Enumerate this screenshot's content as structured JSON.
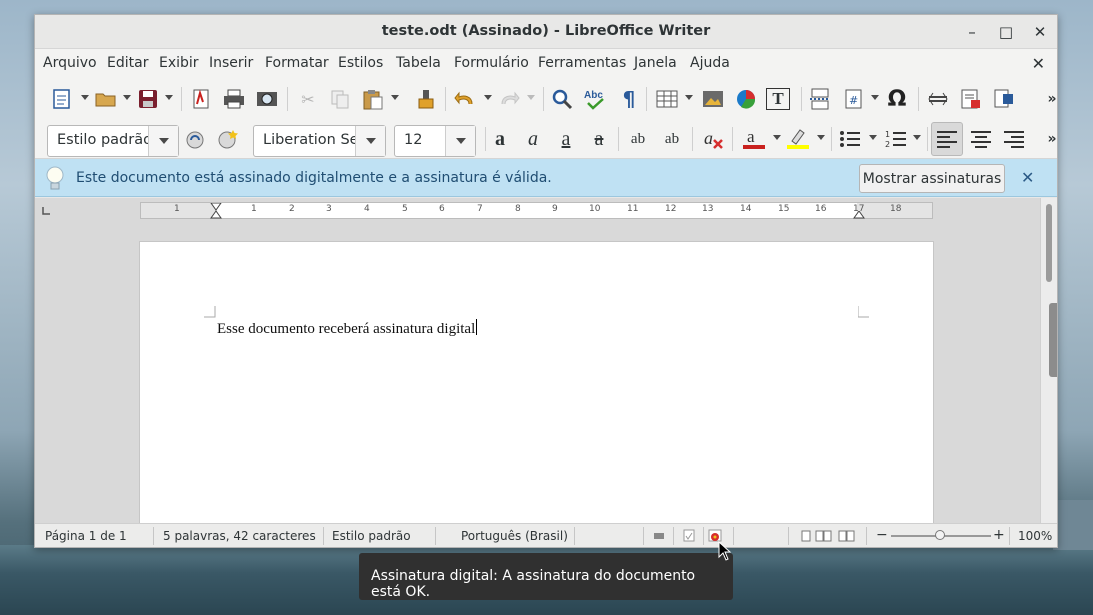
{
  "window": {
    "title": "teste.odt (Assinado) - LibreOffice Writer",
    "controls": {
      "minimize": "–",
      "maximize": "□",
      "close": "✕"
    }
  },
  "menu": {
    "items": [
      "Arquivo",
      "Editar",
      "Exibir",
      "Inserir",
      "Formatar",
      "Estilos",
      "Tabela",
      "Formulário",
      "Ferramentas",
      "Janela",
      "Ajuda"
    ],
    "close_document": "✕"
  },
  "toolbar": {
    "paragraph_style": "Estilo padrão",
    "font_name": "Liberation Se",
    "font_size": "12",
    "format_buttons": {
      "bold": "a",
      "italic": "a",
      "underline": "a",
      "strike": "a",
      "superscript": "ab",
      "subscript": "ab"
    },
    "special_char": "Ω",
    "text_box": "T",
    "more": "»"
  },
  "infobar": {
    "message": "Este documento está assinado digitalmente e a assinatura é válida.",
    "button": "Mostrar assinaturas",
    "close": "✕"
  },
  "ruler": {
    "numbers": [
      "1",
      "1",
      "2",
      "3",
      "4",
      "5",
      "6",
      "7",
      "8",
      "9",
      "10",
      "11",
      "12",
      "13",
      "14",
      "15",
      "16",
      "17",
      "18"
    ]
  },
  "document": {
    "text": "Esse documento receberá assinatura digital"
  },
  "statusbar": {
    "page": "Página 1 de 1",
    "words": "5 palavras, 42 caracteres",
    "style": "Estilo padrão",
    "language": "Português (Brasil)",
    "zoom_minus": "−",
    "zoom_plus": "+",
    "zoom": "100%"
  },
  "tooltip": {
    "text": "Assinatura digital: A assinatura do documento está OK."
  },
  "colors": {
    "infobar_bg": "#bfe1f3",
    "font_color": "#c9211e",
    "highlight_color": "#ffff00"
  }
}
